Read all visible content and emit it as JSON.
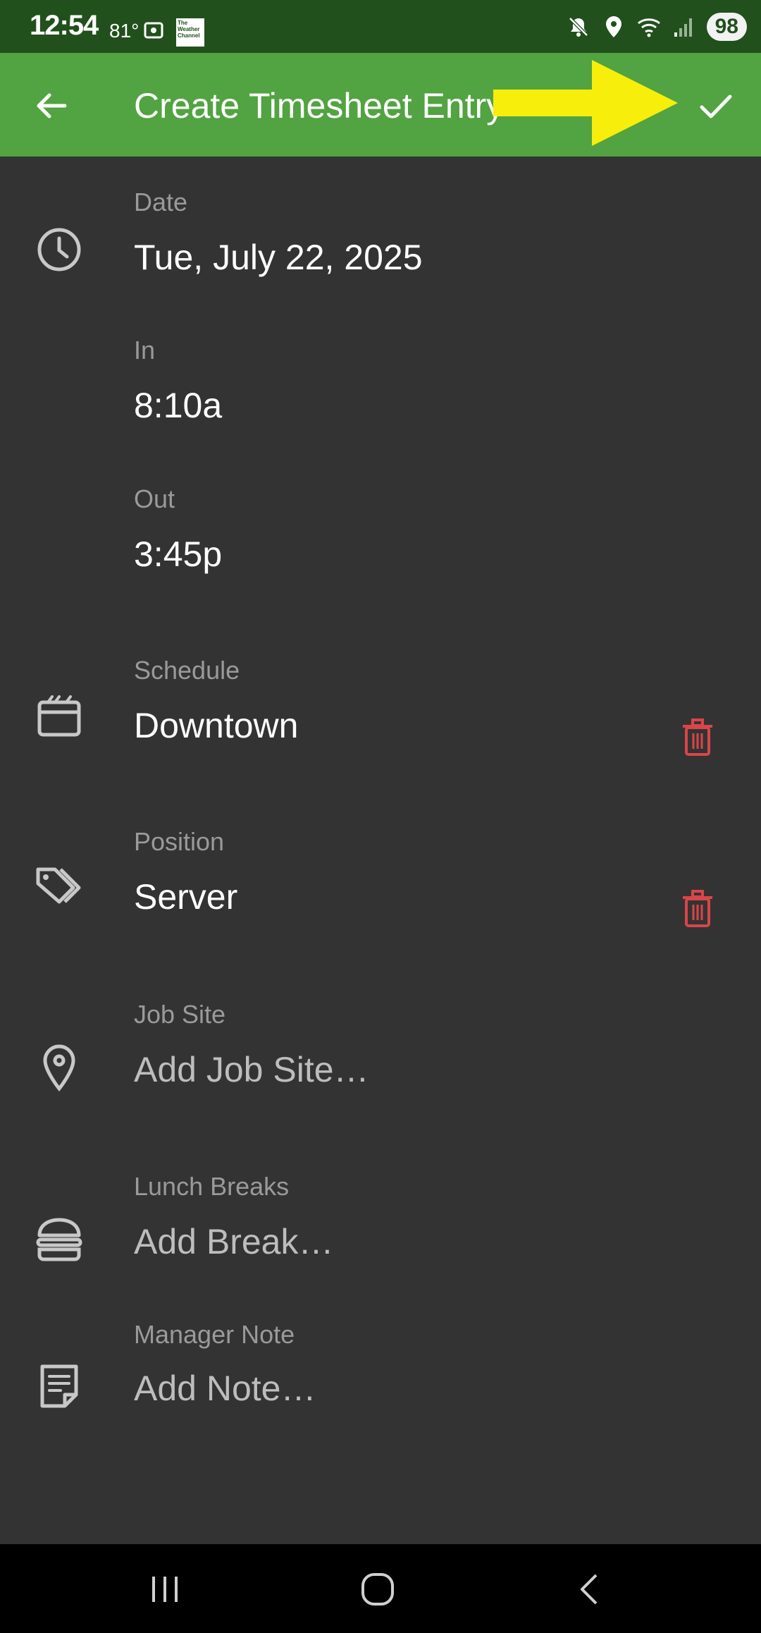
{
  "status_bar": {
    "time": "12:54",
    "temperature": "81°",
    "weather_badge": "The Weather Channel",
    "battery": "98",
    "icons": [
      "gallery-icon",
      "weather-channel-icon",
      "mute-icon",
      "location-icon",
      "wifi-icon",
      "signal-icon",
      "battery-icon"
    ]
  },
  "app_bar": {
    "title": "Create Timesheet Entry",
    "back_icon": "arrow-left-icon",
    "confirm_icon": "check-icon",
    "annotation": "yellow-arrow-icon"
  },
  "colors": {
    "status_bar": "#21501c",
    "app_bar": "#52a341",
    "background": "#333333",
    "delete": "#d9454a",
    "annotation_arrow": "#f7ee0b"
  },
  "form": {
    "date": {
      "label": "Date",
      "value": "Tue, July 22, 2025",
      "icon": "clock-icon"
    },
    "in": {
      "label": "In",
      "value": "8:10a"
    },
    "out": {
      "label": "Out",
      "value": "3:45p"
    },
    "schedule": {
      "label": "Schedule",
      "value": "Downtown",
      "icon": "calendar-icon",
      "action_icon": "trash-icon"
    },
    "position": {
      "label": "Position",
      "value": "Server",
      "icon": "tags-icon",
      "action_icon": "trash-icon"
    },
    "job_site": {
      "label": "Job Site",
      "placeholder": "Add Job Site…",
      "icon": "location-pin-icon"
    },
    "lunch_breaks": {
      "label": "Lunch Breaks",
      "placeholder": "Add Break…",
      "icon": "burger-icon"
    },
    "manager_note": {
      "label": "Manager Note",
      "placeholder": "Add Note…",
      "icon": "note-icon"
    }
  },
  "nav_bar": {
    "icons": [
      "recent-apps-icon",
      "home-icon",
      "back-icon"
    ]
  }
}
